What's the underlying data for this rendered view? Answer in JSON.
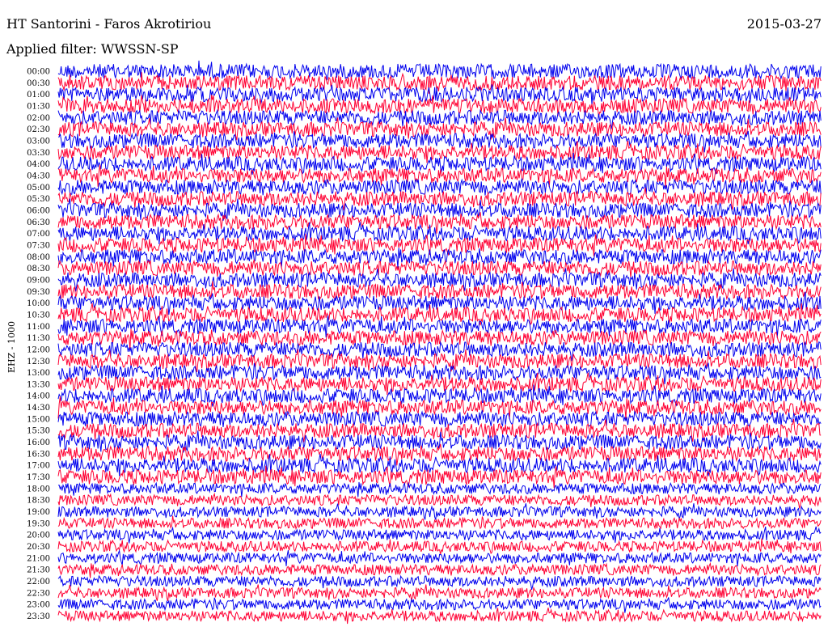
{
  "header": {
    "title": "HT Santorini - Faros Akrotiriou",
    "date": "2015-03-27",
    "filter": "Applied filter: WWSSN-SP"
  },
  "axis": {
    "channel_label": "EHZ - 1000"
  },
  "chart_data": {
    "type": "line",
    "x_axis": "minutes within each row (0–30)",
    "row_labels": [
      "00:00",
      "00:30",
      "01:00",
      "01:30",
      "02:00",
      "02:30",
      "03:00",
      "03:30",
      "04:00",
      "04:30",
      "05:00",
      "05:30",
      "06:00",
      "06:30",
      "07:00",
      "07:30",
      "08:00",
      "08:30",
      "09:00",
      "09:30",
      "10:00",
      "10:30",
      "11:00",
      "11:30",
      "12:00",
      "12:30",
      "13:00",
      "13:30",
      "14:00",
      "14:30",
      "15:00",
      "15:30",
      "16:00",
      "16:30",
      "17:00",
      "17:30",
      "18:00",
      "18:30",
      "19:00",
      "19:30",
      "20:00",
      "20:30",
      "21:00",
      "21:30",
      "22:00",
      "22:30",
      "23:00",
      "23:30"
    ],
    "colors": [
      "#0000ee",
      "#ff0033"
    ],
    "grid": false,
    "legend": "none"
  }
}
